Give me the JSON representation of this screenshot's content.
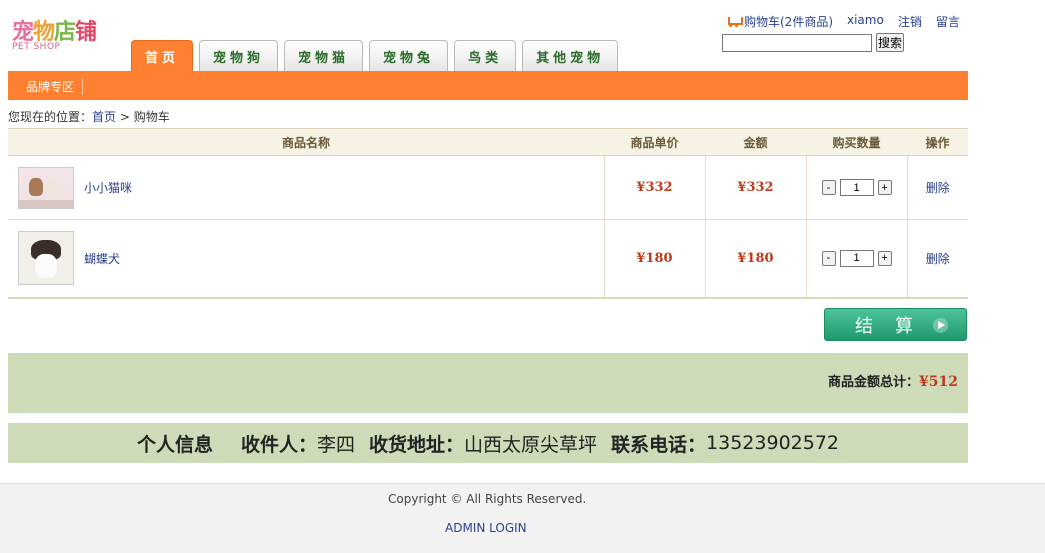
{
  "logo": {
    "text_cn": [
      "宠",
      "物",
      "店",
      "铺"
    ],
    "text_en": "PET SHOP"
  },
  "top_links": {
    "cart": "购物车(2件商品)",
    "user": "xiamo",
    "logout": "注销",
    "message": "留言"
  },
  "search": {
    "value": "",
    "button": "搜索"
  },
  "tabs": [
    {
      "label": "首页",
      "active": true
    },
    {
      "label": "宠物狗",
      "active": false
    },
    {
      "label": "宠物猫",
      "active": false
    },
    {
      "label": "宠物兔",
      "active": false
    },
    {
      "label": "鸟类",
      "active": false
    },
    {
      "label": "其他宠物",
      "active": false
    }
  ],
  "subnav": {
    "brand": "品牌专区"
  },
  "breadcrumb": {
    "prefix": "您现在的位置：",
    "home": "首页",
    "sep": ">",
    "current": "购物车"
  },
  "table": {
    "headers": {
      "name": "商品名称",
      "unit_price": "商品单价",
      "amount": "金额",
      "quantity": "购买数量",
      "action": "操作"
    },
    "rows": [
      {
        "name": "小小猫咪",
        "unit_price": "¥332",
        "amount": "¥332",
        "qty": "1",
        "minus": "-",
        "plus": "+",
        "delete": "删除",
        "image": "cat-photo"
      },
      {
        "name": "蝴蝶犬",
        "unit_price": "¥180",
        "amount": "¥180",
        "qty": "1",
        "minus": "-",
        "plus": "+",
        "delete": "删除",
        "image": "dog-photo"
      }
    ]
  },
  "checkout": {
    "label": "结算"
  },
  "total": {
    "label": "商品金额总计：",
    "value": "¥512"
  },
  "info": {
    "title": "个人信息",
    "receiver_label": "收件人：",
    "receiver": "李四",
    "address_label": "收货地址：",
    "address": "山西太原尖草坪",
    "phone_label": "联系电话：",
    "phone": "13523902572"
  },
  "footer": {
    "copyright": "Copyright © All Rights Reserved.",
    "admin": "ADMIN LOGIN"
  },
  "colors": {
    "accent": "#ff8030",
    "price": "#c0391b",
    "panel": "#cedbb8",
    "checkout": "#1f9a6c"
  }
}
